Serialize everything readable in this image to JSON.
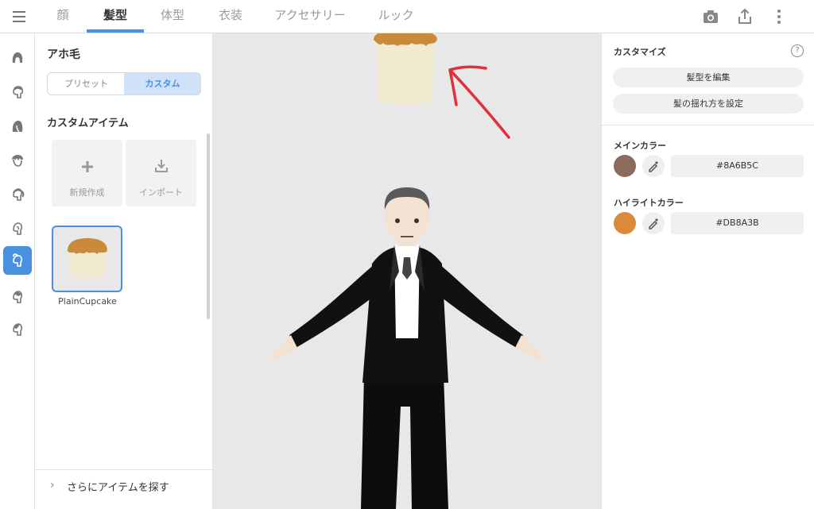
{
  "header": {
    "tabs": [
      {
        "label": "顔"
      },
      {
        "label": "髪型"
      },
      {
        "label": "体型"
      },
      {
        "label": "衣装"
      },
      {
        "label": "アクセサリー"
      },
      {
        "label": "ルック"
      }
    ],
    "active_tab": "髪型",
    "icons": [
      "menu-icon",
      "camera-icon",
      "share-icon",
      "more-vertical-icon"
    ]
  },
  "rail": {
    "items": [
      "hair-front-icon",
      "hair-side-icon",
      "hair-back-icon",
      "hair-bangs-icon",
      "hair-ponytail-icon",
      "hair-ear-icon",
      "ahoge-icon",
      "hair-extra-icon",
      "hair-accent-icon"
    ],
    "active_index": 6
  },
  "left_panel": {
    "title": "アホ毛",
    "segments": [
      "プリセット",
      "カスタム"
    ],
    "active_segment": "カスタム",
    "section_title": "カスタムアイテム",
    "actions": [
      {
        "label": "新規作成",
        "icon": "plus-icon"
      },
      {
        "label": "インポート",
        "icon": "import-icon"
      }
    ],
    "items": [
      {
        "name": "PlainCupcake"
      }
    ],
    "find_more": "さらにアイテムを探す"
  },
  "right_panel": {
    "title": "カスタマイズ",
    "buttons": [
      "髪型を編集",
      "髪の揺れ方を設定"
    ],
    "main_color": {
      "label": "メインカラー",
      "hex": "#8A6B5C"
    },
    "highlight_color": {
      "label": "ハイライトカラー",
      "hex": "#DB8A3B"
    }
  },
  "colors": {
    "accent": "#4a90e2",
    "cupcake_top": "#c98a3b",
    "cupcake_base": "#f1ead0",
    "annotation_arrow": "#e0303a"
  }
}
